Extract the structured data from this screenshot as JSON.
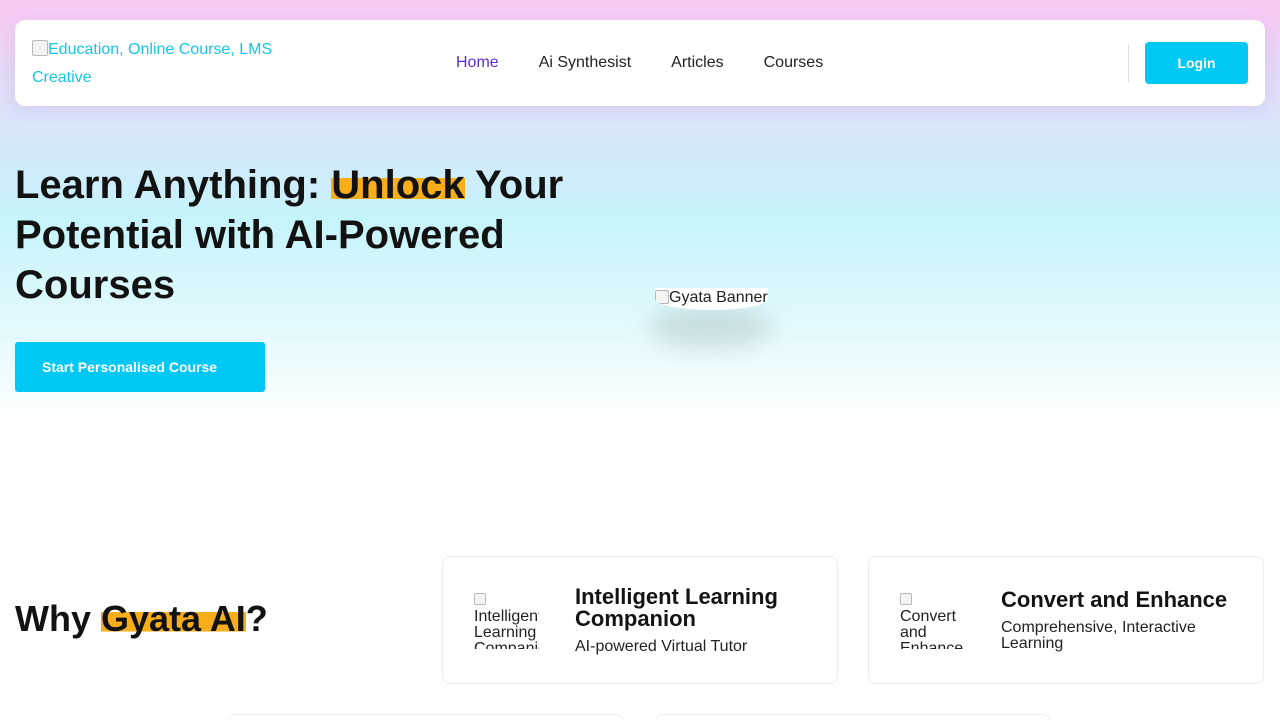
{
  "header": {
    "logo_alt": "Education, Online Course, LMS Creative",
    "nav": [
      {
        "label": "Home",
        "active": true
      },
      {
        "label": "Ai Synthesist",
        "active": false
      },
      {
        "label": "Articles",
        "active": false
      },
      {
        "label": "Courses",
        "active": false
      }
    ],
    "login_label": "Login"
  },
  "hero": {
    "title_part1": "Learn Anything: ",
    "title_highlight": "Unlock",
    "title_part2": " Your Potential with AI-Powered Courses",
    "cta_label": "Start Personalised Course",
    "banner_alt": "Gyata Banner"
  },
  "why": {
    "title_part1": "Why ",
    "title_highlight": "Gyata AI",
    "title_part2": "?"
  },
  "features": [
    {
      "img_alt": "Intelligent Learning Companion",
      "title": "Intelligent Learning Companion",
      "subtitle": "AI-powered Virtual Tutor"
    },
    {
      "img_alt": "Convert and Enhance",
      "title": "Convert and Enhance",
      "subtitle": "Comprehensive, Interactive Learning"
    }
  ],
  "colors": {
    "accent": "#00c8f5",
    "highlight": "#f8ae1b",
    "nav_active": "#5b2fd0",
    "logo_text": "#16c6e6"
  }
}
